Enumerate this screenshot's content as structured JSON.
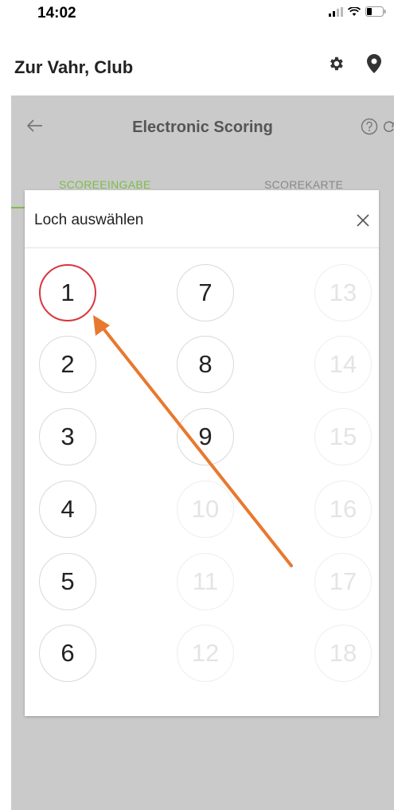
{
  "status_bar": {
    "time": "14:02"
  },
  "app_bar": {
    "title": "Zur Vahr, Club",
    "icons": [
      "gear-icon",
      "location-pin-icon"
    ]
  },
  "sub_bar": {
    "title": "Electronic Scoring",
    "icons": [
      "back-arrow-icon",
      "help-icon",
      "refresh-icon"
    ]
  },
  "tabs": [
    {
      "label": "SCOREEINGABE",
      "active": true
    },
    {
      "label": "SCOREKARTE",
      "active": false
    }
  ],
  "dialog": {
    "title": "Loch auswählen",
    "holes": [
      {
        "label": "1",
        "enabled": true,
        "selected": true
      },
      {
        "label": "2",
        "enabled": true
      },
      {
        "label": "3",
        "enabled": true
      },
      {
        "label": "4",
        "enabled": true
      },
      {
        "label": "5",
        "enabled": true
      },
      {
        "label": "6",
        "enabled": true
      },
      {
        "label": "7",
        "enabled": true
      },
      {
        "label": "8",
        "enabled": true
      },
      {
        "label": "9",
        "enabled": true
      },
      {
        "label": "10",
        "enabled": false
      },
      {
        "label": "11",
        "enabled": false
      },
      {
        "label": "12",
        "enabled": false
      },
      {
        "label": "13",
        "enabled": false
      },
      {
        "label": "14",
        "enabled": false
      },
      {
        "label": "15",
        "enabled": false
      },
      {
        "label": "16",
        "enabled": false
      },
      {
        "label": "17",
        "enabled": false
      },
      {
        "label": "18",
        "enabled": false
      }
    ]
  },
  "annotation": {
    "color": "#e8782f",
    "marker_color": "#d9363e"
  }
}
